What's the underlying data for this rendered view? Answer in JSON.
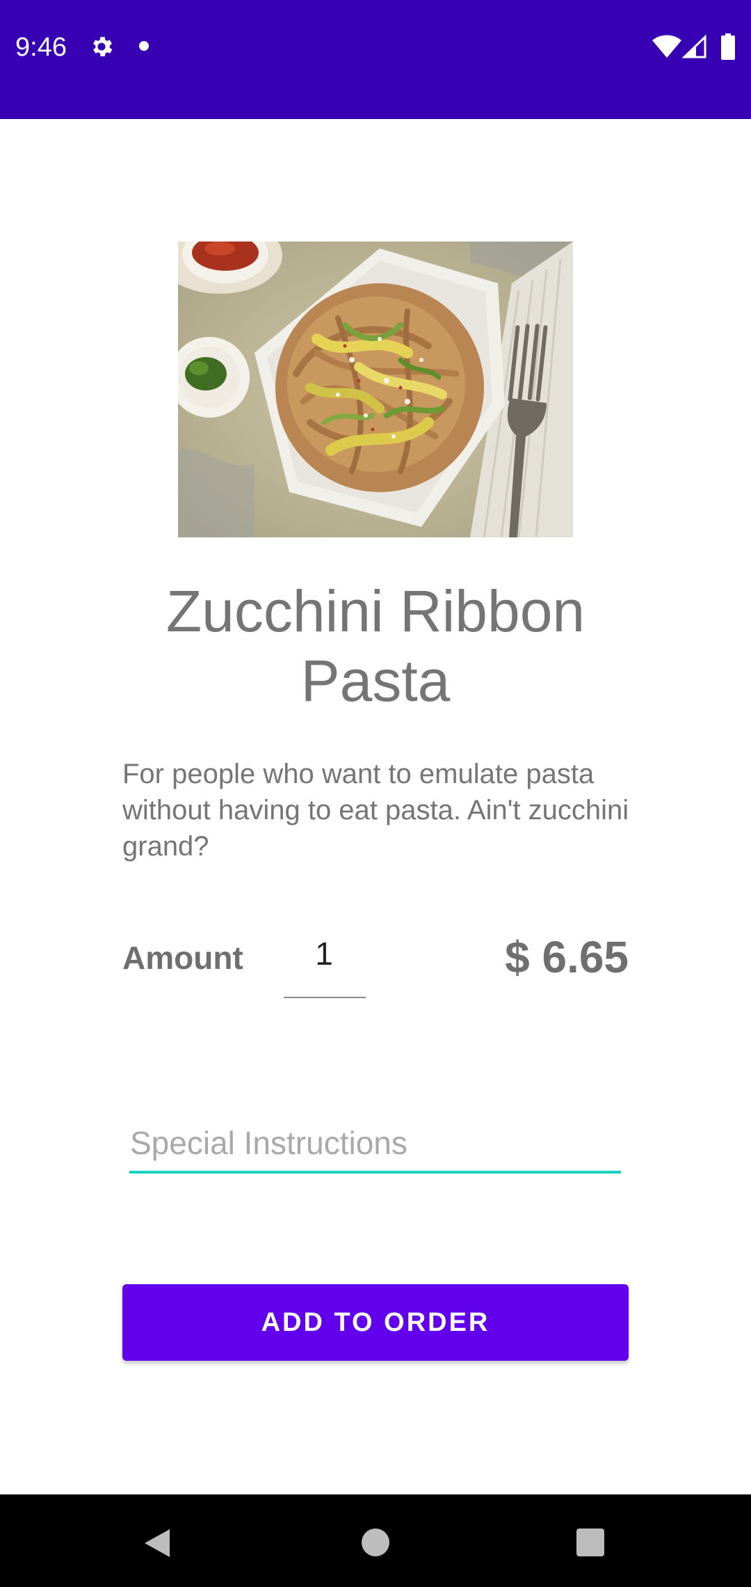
{
  "status_bar": {
    "time": "9:46",
    "background_color": "#3700B3",
    "icons": [
      "gear-icon",
      "notification-dot-icon",
      "wifi-icon",
      "signal-icon",
      "battery-icon"
    ]
  },
  "dish": {
    "image_icon": "pasta-dish-image",
    "title": "Zucchini Ribbon Pasta",
    "description": "For people who want to emulate pasta without having to eat pasta. Ain't zucchini grand?"
  },
  "order": {
    "amount_label": "Amount",
    "amount_value": "1",
    "price": "$ 6.65"
  },
  "instructions": {
    "placeholder": "Special Instructions",
    "underline_color": "#18D2BE"
  },
  "add_button": {
    "label": "ADD TO ORDER",
    "color": "#6200EE"
  },
  "nav_bar": {
    "icons": [
      "back-icon",
      "home-icon",
      "recents-icon"
    ]
  }
}
